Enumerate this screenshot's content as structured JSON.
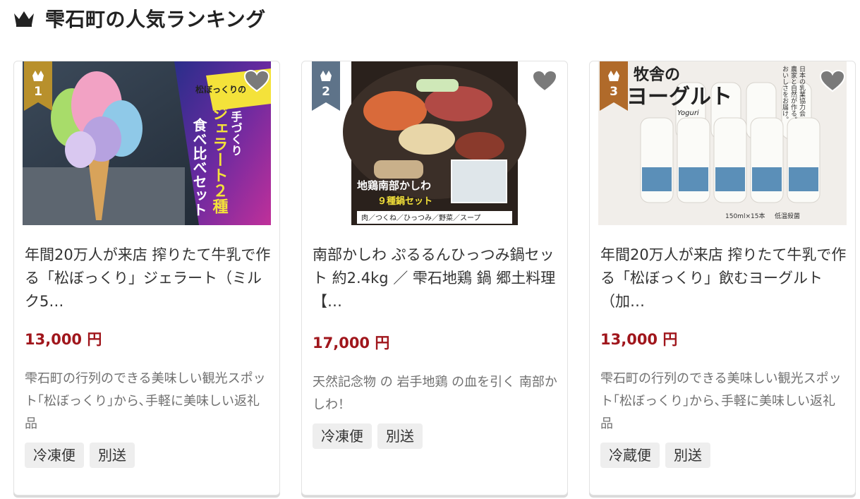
{
  "heading": {
    "title": "雫石町の人気ランキング",
    "icon": "crown-icon"
  },
  "colors": {
    "gold": "#b8902c",
    "silver": "#5e7389",
    "bronze": "#b06a2a",
    "price": "#a0161c",
    "heart": "#7a7a7a"
  },
  "cards": [
    {
      "rank": "1",
      "title": "年間20万人が来店 搾りたて牛乳で作る「松ぼっくり」ジェラート（ミルク5…",
      "price": "13,000 円",
      "description": "雫石町の行列のできる美味しい観光スポット｢松ぼっくり｣から､手軽に美味しい返礼品",
      "tags": [
        "冷凍便",
        "別送"
      ],
      "image_text": [
        "松ぼっくりの",
        "手づくり",
        "ジェラート２種",
        "食べ比べセット"
      ]
    },
    {
      "rank": "2",
      "title": "南部かしわ ぷるるんひっつみ鍋セット 約2.4kg ／ 雫石地鶏 鍋 郷土料理【…",
      "price": "17,000 円",
      "description": "天然記念物 の 岩手地鶏 の血を引く 南部かしわ！",
      "tags": [
        "冷凍便",
        "別送"
      ],
      "image_text": [
        "地鶏南部かしわ",
        "９種鍋セット",
        "肉／つくね／ひっつみ／野菜／スープ"
      ]
    },
    {
      "rank": "3",
      "title": "年間20万人が来店 搾りたて牛乳で作る「松ぼっくり」飲むヨーグルト（加…",
      "price": "13,000 円",
      "description": "雫石町の行列のできる美味しい観光スポット｢松ぼっくり｣から､手軽に美味しい返礼品",
      "tags": [
        "冷蔵便",
        "別送"
      ],
      "image_text": [
        "牧舎の",
        "ヨーグルト",
        "Yoguri",
        "日本の乳業協力会",
        "農家と自然が作る。",
        "おいしさをお届け。",
        "150ml×15本",
        "低温殺菌"
      ]
    }
  ]
}
